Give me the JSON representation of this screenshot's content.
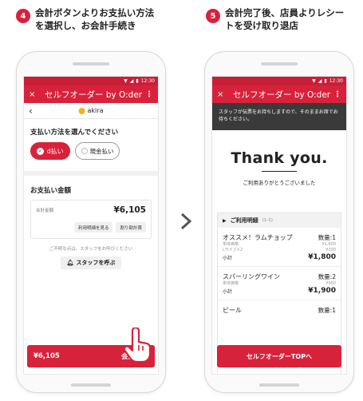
{
  "steps": [
    {
      "number": "4",
      "text": "会計ボタンよりお支払い方法\nを選択し、お会計手続き"
    },
    {
      "number": "5",
      "text": "会計完了後、店員よりレシー\nトを受け取り退店"
    }
  ],
  "phone1": {
    "status_time": "12:30",
    "appbar": {
      "close": "×",
      "title": "セルフオーダー by O:der",
      "menu": "⋮"
    },
    "shop_name": "akira",
    "payment_method_label": "支払い方法を選んでください",
    "pay_options": [
      "d払い",
      "現金払い"
    ],
    "amount_label": "お支払い金額",
    "total_key": "合計金額",
    "total_value": "¥6,105",
    "detail_button": "利用明細を見る",
    "split_button": "割り勘計算",
    "help_text": "ご不明な点は、スタッフをお呼びください",
    "staff_button": "スタッフを呼ぶ",
    "checkout_amount": "¥6,105",
    "checkout_label": "会計する"
  },
  "phone2": {
    "status_time": "12:30",
    "appbar": {
      "close": "×",
      "title": "セルフオーダー by O:der",
      "menu": "⋮"
    },
    "notice": "スタッフが伝票をお持ちしますので、そのままお席でお待ちください。",
    "thanks": "Thank you.",
    "thanks_sub": "ご利用ありがとうございました",
    "receipt_header": "ご利用明細",
    "receipt_header_sub": "(1-1)",
    "items": [
      {
        "name": "オススメ！ラムチョップ",
        "qty": "数量:1",
        "lines": [
          [
            "単体価格",
            "¥1,600"
          ],
          [
            "Lサイズ×2",
            "¥200"
          ]
        ],
        "subtotal_label": "小計",
        "subtotal": "¥1,800"
      },
      {
        "name": "スパーリングワイン",
        "qty": "数量:2",
        "lines": [
          [
            "単体価格",
            "¥950"
          ]
        ],
        "subtotal_label": "小計",
        "subtotal": "¥1,900"
      },
      {
        "name": "ビール",
        "qty": "数量:1",
        "lines": [],
        "subtotal_label": "",
        "subtotal": ""
      }
    ],
    "top_button": "セルフオーダーTOPへ"
  },
  "colors": {
    "accent": "#d8223b",
    "notice_bg": "#3a3a3a"
  }
}
